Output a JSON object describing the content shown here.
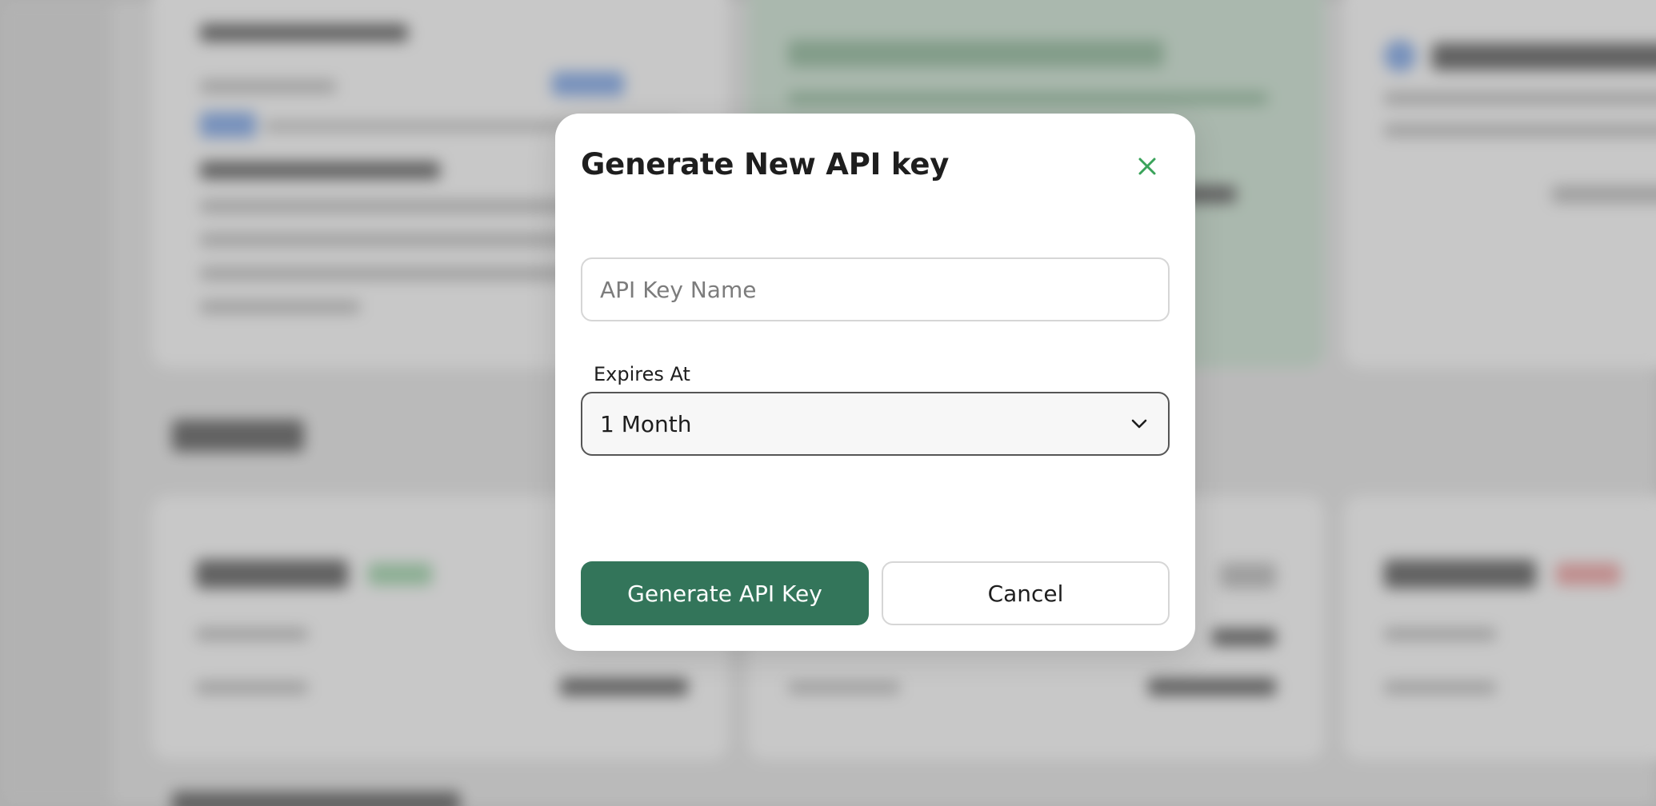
{
  "modal": {
    "title": "Generate New API key",
    "close_icon": "close-icon",
    "name_input": {
      "placeholder": "API Key Name",
      "value": ""
    },
    "expires": {
      "label": "Expires At",
      "selected": "1 Month",
      "chevron_icon": "chevron-down-icon"
    },
    "generate_button": "Generate API Key",
    "cancel_button": "Cancel"
  },
  "colors": {
    "primary": "#33755a",
    "close_icon": "#3aa35a",
    "overlay": "rgba(110,110,110,0.38)"
  }
}
